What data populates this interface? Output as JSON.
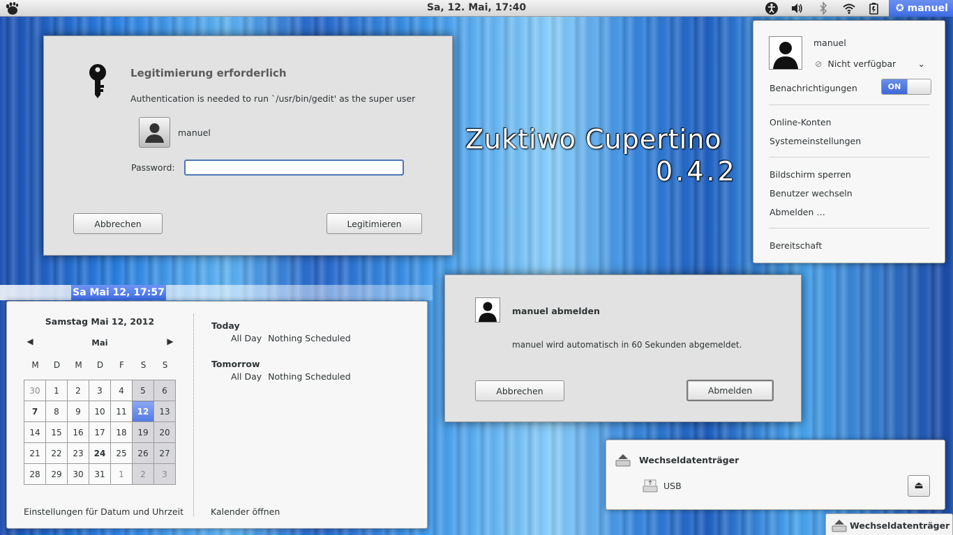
{
  "topbar": {
    "clock": "Sa, 12. Mai, 17:40",
    "user_name": "manuel",
    "icons": [
      "gnome-foot-icon",
      "accessibility-icon",
      "volume-icon",
      "bluetooth-icon",
      "wifi-icon",
      "battery-icon",
      "status-icon"
    ]
  },
  "auth_dialog": {
    "title": "Legitimierung erforderlich",
    "description": "Authentication is needed to run `/usr/bin/gedit' as the super user",
    "user": "manuel",
    "password_label": "Password:",
    "password_value": "",
    "cancel_label": "Abbrechen",
    "confirm_label": "Legitimieren"
  },
  "theme": {
    "title": "Zuktiwo Cupertino",
    "version": "0.4.2"
  },
  "user_menu": {
    "name": "manuel",
    "status": "Nicht verfügbar",
    "notifications_label": "Benachrichtigungen",
    "notifications_state": "ON",
    "items_group1": [
      "Online-Konten",
      "Systemeinstellungen"
    ],
    "items_group2": [
      "Bildschirm sperren",
      "Benutzer wechseln",
      "Abmelden …"
    ],
    "items_group3": [
      "Bereitschaft"
    ]
  },
  "calendar": {
    "tab_label": "Sa Mai 12, 17:57",
    "date_header": "Samstag Mai 12, 2012",
    "month": "Mai",
    "weekdays": [
      "M",
      "D",
      "M",
      "D",
      "F",
      "S",
      "S"
    ],
    "weeks": [
      [
        "30",
        "1",
        "2",
        "3",
        "4",
        "5",
        "6"
      ],
      [
        "7",
        "8",
        "9",
        "10",
        "11",
        "12",
        "13"
      ],
      [
        "14",
        "15",
        "16",
        "17",
        "18",
        "19",
        "20"
      ],
      [
        "21",
        "22",
        "23",
        "24",
        "25",
        "26",
        "27"
      ],
      [
        "28",
        "29",
        "30",
        "31",
        "1",
        "2",
        "3"
      ]
    ],
    "today": "12",
    "events": {
      "today_label": "Today",
      "today_time": "All Day",
      "today_text": "Nothing Scheduled",
      "tomorrow_label": "Tomorrow",
      "tomorrow_time": "All Day",
      "tomorrow_text": "Nothing Scheduled"
    },
    "settings_link": "Einstellungen für Datum und Uhrzeit",
    "open_link": "Kalender öffnen"
  },
  "logout_dialog": {
    "title": "manuel abmelden",
    "message": "manuel wird automatisch in 60 Sekunden abgemeldet.",
    "cancel_label": "Abbrechen",
    "confirm_label": "Abmelden"
  },
  "devices": {
    "title": "Wechseldatenträger",
    "device": "USB",
    "eject_symbol": "⏏",
    "tab_label": "Wechseldatenträger"
  }
}
